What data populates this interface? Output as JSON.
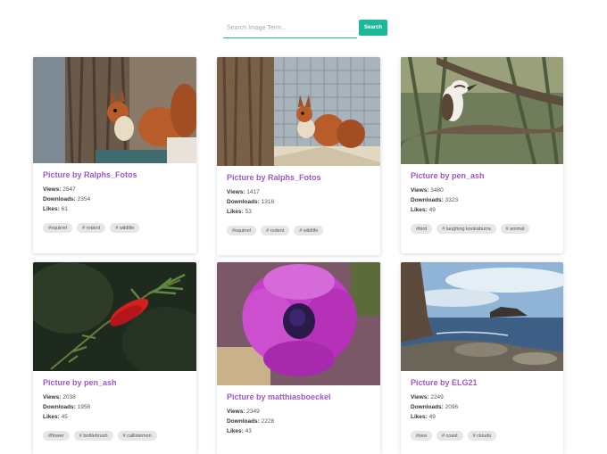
{
  "search": {
    "placeholder": "Search Image Term...",
    "value": "",
    "button_label": "Search"
  },
  "labels": {
    "views": "Views:",
    "downloads": "Downloads:",
    "likes": "Likes:"
  },
  "cards": [
    {
      "title": "Picture by Ralphs_Fotos",
      "views": "2547",
      "downloads": "2354",
      "likes": "61",
      "tags": [
        "#squirrel",
        "# rodent",
        "# wildlife"
      ],
      "image": "squirrel-on-tree-stump"
    },
    {
      "title": "Picture by Ralphs_Fotos",
      "views": "1417",
      "downloads": "1316",
      "likes": "53",
      "tags": [
        "#squirrel",
        "# rodent",
        "# wildlife"
      ],
      "image": "squirrel-on-birdhouse"
    },
    {
      "title": "Picture by pen_ash",
      "views": "3480",
      "downloads": "3323",
      "likes": "49",
      "tags": [
        "#bird",
        "# laughing kookaburra",
        "# animal"
      ],
      "image": "kookaburra-on-branch"
    },
    {
      "title": "Picture by pen_ash",
      "views": "2038",
      "downloads": "1958",
      "likes": "45",
      "tags": [
        "#flower",
        "# bottlebrush",
        "# callistemon"
      ],
      "image": "red-bottlebrush-flower"
    },
    {
      "title": "Picture by matthiasboeckel",
      "views": "2349",
      "downloads": "2228",
      "likes": "43",
      "tags": [],
      "image": "purple-anemone-flower"
    },
    {
      "title": "Picture by ELG21",
      "views": "2249",
      "downloads": "2096",
      "likes": "49",
      "tags": [
        "#sea",
        "# coast",
        "# clouds"
      ],
      "image": "rocky-sea-coast"
    }
  ]
}
